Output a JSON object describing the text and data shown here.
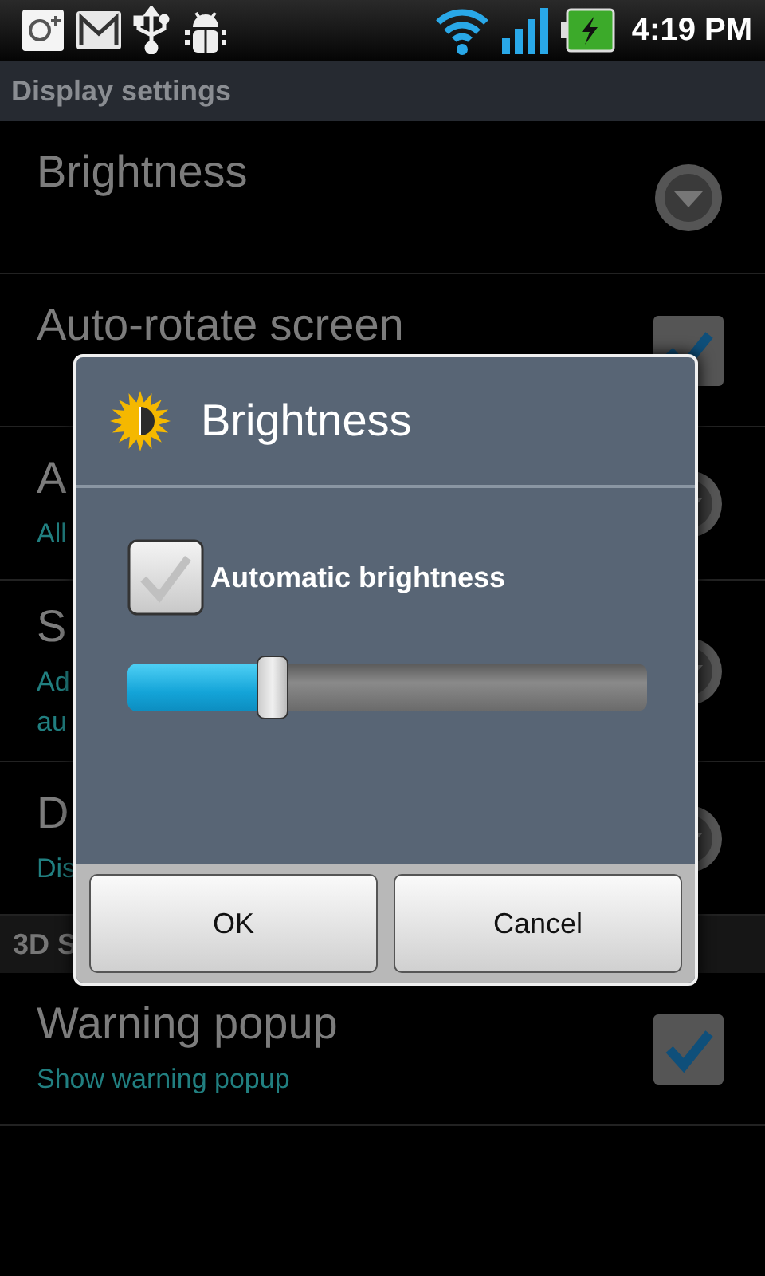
{
  "status_bar": {
    "time": "4:19 PM"
  },
  "header": {
    "title": "Display settings"
  },
  "list": [
    {
      "kind": "dropdown",
      "title": "Brightness"
    },
    {
      "kind": "checkbox",
      "title": "Auto-rotate screen",
      "checked": true
    },
    {
      "kind": "dropdown",
      "title": "A",
      "subtitle": [
        "All"
      ]
    },
    {
      "kind": "dropdown",
      "title": "S",
      "subtitle": [
        "Ad",
        "au"
      ]
    },
    {
      "kind": "dropdown",
      "title": "D",
      "subtitle": [
        "Dis"
      ]
    },
    {
      "kind": "section",
      "title": "3D S"
    },
    {
      "kind": "checkbox",
      "title": "Warning popup",
      "subtitle": [
        "Show warning popup"
      ],
      "checked": true
    }
  ],
  "dialog": {
    "title": "Brightness",
    "auto": {
      "label": "Automatic brightness",
      "checked": false
    },
    "slider": {
      "level": 0.28
    },
    "buttons": [
      "OK",
      "Cancel"
    ]
  }
}
